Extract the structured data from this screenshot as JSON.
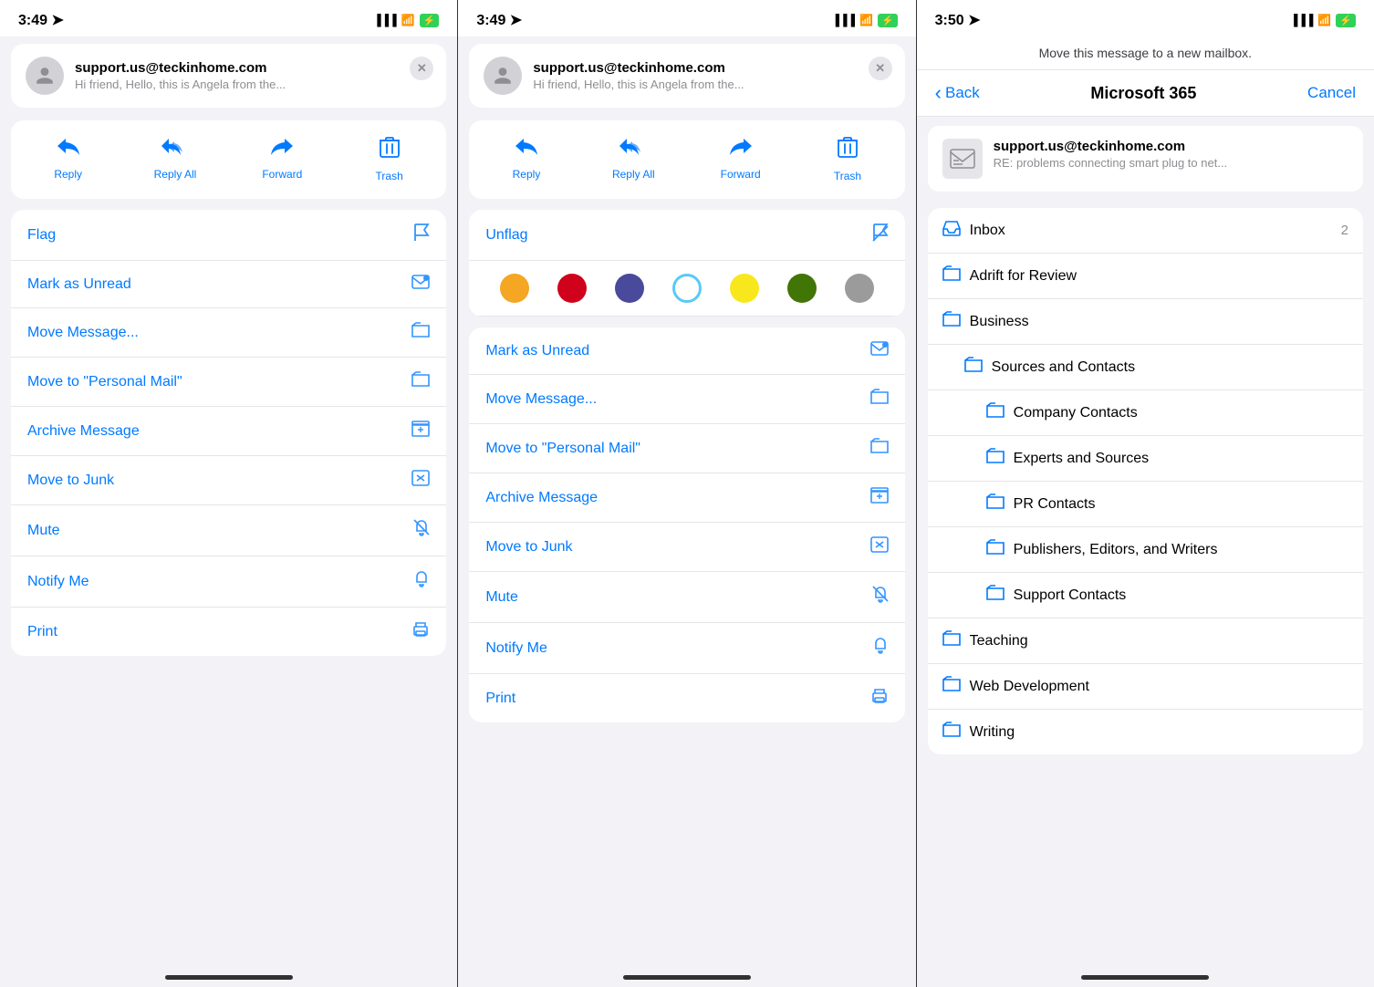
{
  "screens": [
    {
      "id": "screen1",
      "statusBar": {
        "time": "3:49",
        "hasArrow": true
      },
      "emailHeader": {
        "from": "support.us@teckinhome.com",
        "preview": "Hi friend,   Hello, this is Angela from the..."
      },
      "actionButtons": [
        {
          "id": "reply",
          "label": "Reply",
          "icon": "↩"
        },
        {
          "id": "reply-all",
          "label": "Reply All",
          "icon": "↩↩"
        },
        {
          "id": "forward",
          "label": "Forward",
          "icon": "↪"
        },
        {
          "id": "trash",
          "label": "Trash",
          "icon": "🗑"
        }
      ],
      "menuItems": [
        {
          "id": "flag",
          "label": "Flag",
          "icon": "⚑"
        },
        {
          "id": "mark-unread",
          "label": "Mark as Unread",
          "icon": "✉"
        },
        {
          "id": "move-message",
          "label": "Move Message...",
          "icon": "📁"
        },
        {
          "id": "move-personal",
          "label": "Move to \"Personal Mail\"",
          "icon": "📁"
        },
        {
          "id": "archive",
          "label": "Archive Message",
          "icon": "📦"
        },
        {
          "id": "junk",
          "label": "Move to Junk",
          "icon": "⊠"
        },
        {
          "id": "mute",
          "label": "Mute",
          "icon": "🔕"
        },
        {
          "id": "notify",
          "label": "Notify Me",
          "icon": "🔔"
        },
        {
          "id": "print",
          "label": "Print",
          "icon": "🖨"
        }
      ]
    },
    {
      "id": "screen2",
      "statusBar": {
        "time": "3:49",
        "hasArrow": true
      },
      "emailHeader": {
        "from": "support.us@teckinhome.com",
        "preview": "Hi friend,   Hello, this is Angela from the..."
      },
      "actionButtons": [
        {
          "id": "reply",
          "label": "Reply",
          "icon": "↩"
        },
        {
          "id": "reply-all",
          "label": "Reply All",
          "icon": "↩↩"
        },
        {
          "id": "forward",
          "label": "Forward",
          "icon": "↪"
        },
        {
          "id": "trash",
          "label": "Trash",
          "icon": "🗑"
        }
      ],
      "hasColorDots": true,
      "colorDots": [
        {
          "id": "orange",
          "class": "dot-orange"
        },
        {
          "id": "red",
          "class": "dot-red"
        },
        {
          "id": "purple",
          "class": "dot-purple"
        },
        {
          "id": "teal",
          "class": "dot-teal"
        },
        {
          "id": "yellow",
          "class": "dot-yellow"
        },
        {
          "id": "green",
          "class": "dot-green"
        },
        {
          "id": "gray",
          "class": "dot-gray"
        }
      ],
      "flagLabel": "Unflag",
      "menuItems": [
        {
          "id": "mark-unread",
          "label": "Mark as Unread",
          "icon": "✉"
        },
        {
          "id": "move-message",
          "label": "Move Message...",
          "icon": "📁"
        },
        {
          "id": "move-personal",
          "label": "Move to \"Personal Mail\"",
          "icon": "📁"
        },
        {
          "id": "archive",
          "label": "Archive Message",
          "icon": "📦"
        },
        {
          "id": "junk",
          "label": "Move to Junk",
          "icon": "⊠"
        },
        {
          "id": "mute",
          "label": "Mute",
          "icon": "🔕"
        },
        {
          "id": "notify",
          "label": "Notify Me",
          "icon": "🔔"
        },
        {
          "id": "print",
          "label": "Print",
          "icon": "🖨"
        }
      ]
    },
    {
      "id": "screen3",
      "statusBar": {
        "time": "3:50",
        "hasArrow": true
      },
      "headerInfo": "Move this message to a new mailbox.",
      "nav": {
        "back": "Back",
        "title": "Microsoft 365",
        "cancel": "Cancel"
      },
      "messageCard": {
        "from": "support.us@teckinhome.com",
        "subject": "RE: problems connecting smart plug to net..."
      },
      "mailboxes": [
        {
          "id": "inbox",
          "label": "Inbox",
          "count": 2,
          "isInbox": true,
          "indent": 0
        },
        {
          "id": "adrift",
          "label": "Adrift for Review",
          "indent": 0
        },
        {
          "id": "business",
          "label": "Business",
          "indent": 0
        },
        {
          "id": "sources-contacts",
          "label": "Sources and Contacts",
          "indent": 1
        },
        {
          "id": "company-contacts",
          "label": "Company Contacts",
          "indent": 2
        },
        {
          "id": "experts-sources",
          "label": "Experts and Sources",
          "indent": 2
        },
        {
          "id": "pr-contacts",
          "label": "PR Contacts",
          "indent": 2
        },
        {
          "id": "publishers",
          "label": "Publishers, Editors, and Writers",
          "indent": 2
        },
        {
          "id": "support-contacts",
          "label": "Support Contacts",
          "indent": 2
        },
        {
          "id": "teaching",
          "label": "Teaching",
          "indent": 0
        },
        {
          "id": "web-dev",
          "label": "Web Development",
          "indent": 0
        },
        {
          "id": "writing",
          "label": "Writing",
          "indent": 0
        }
      ]
    }
  ],
  "icons": {
    "reply": "↩",
    "reply-all": "↩",
    "forward": "↪",
    "trash": "🗑",
    "flag": "⚑",
    "unflag": "⚐",
    "envelope": "✉",
    "folder": "📁",
    "archive": "📦",
    "junk": "⊠",
    "mute": "🔕",
    "bell": "🔔",
    "print": "🖨",
    "close": "✕",
    "back-arrow": "‹",
    "inbox": "📥",
    "folder-open": "📂"
  }
}
